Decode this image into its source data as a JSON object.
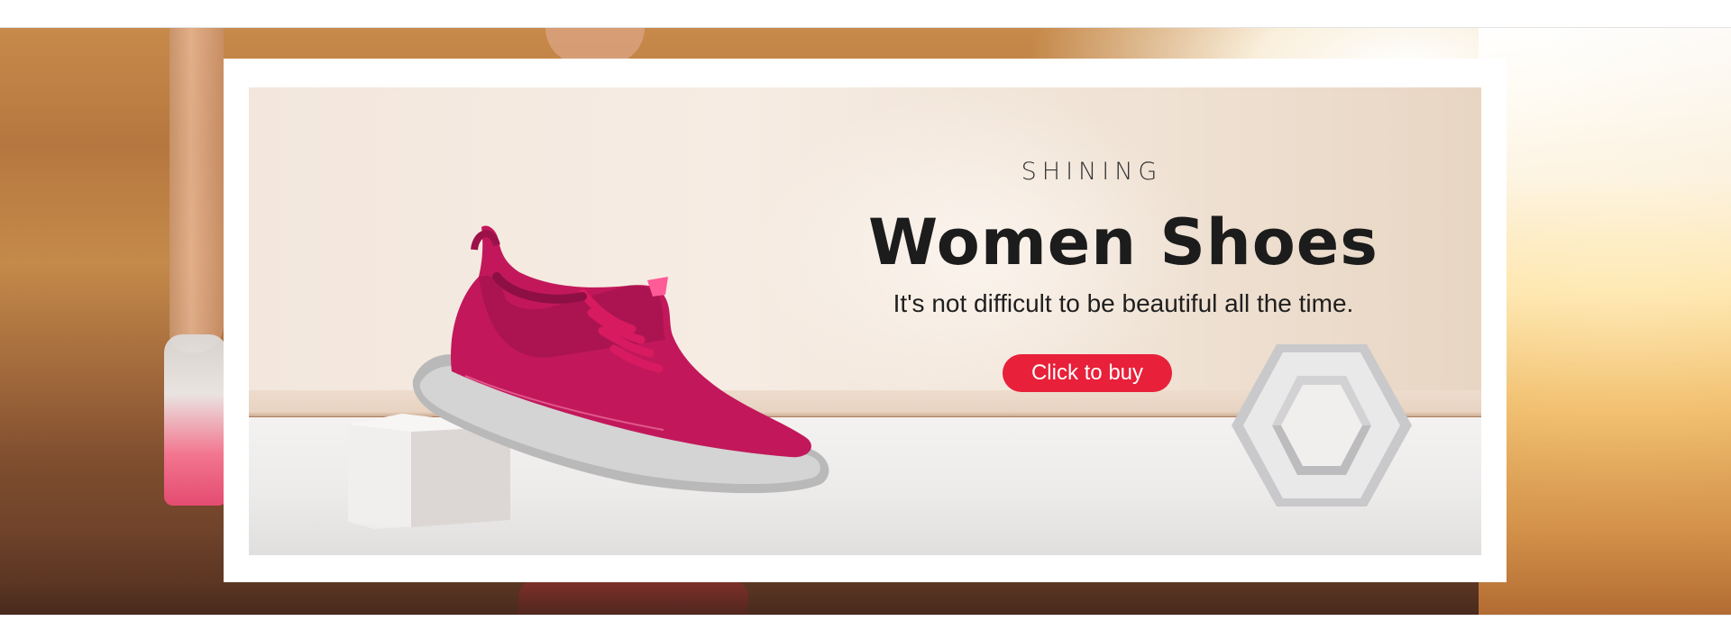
{
  "banner": {
    "eyebrow": "SHINING",
    "headline": "Women Shoes",
    "tagline": "It's not difficult to be beautiful all the time.",
    "cta_label": "Click to buy"
  },
  "colors": {
    "accent": "#e8203a",
    "shoe": "#c2185b",
    "banner_wall": "#f3e7dd",
    "floor": "#ecebea"
  },
  "images": {
    "background": "running-track-sunset-photo",
    "product": "magenta-sneaker",
    "props": [
      "white-cube-pedestal",
      "hexagon-frame"
    ]
  }
}
